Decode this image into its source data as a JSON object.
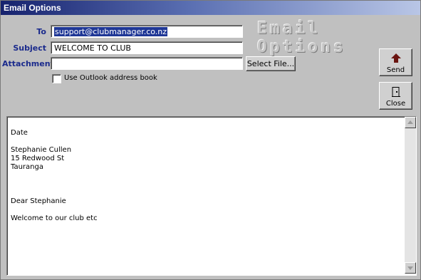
{
  "window": {
    "title": "Email Options"
  },
  "banner": "Email Options",
  "form": {
    "to_label": "To",
    "to_value": "support@clubmanager.co.nz",
    "subject_label": "Subject",
    "subject_value": "WELCOME TO CLUB",
    "attachment_label": "Attachment",
    "attachment_value": "",
    "select_file_label": "Select File...",
    "outlook_label": "Use Outlook address book"
  },
  "buttons": {
    "send_label": "Send",
    "close_label": "Close"
  },
  "message": {
    "body": "Date\n\nStephanie Cullen\n15 Redwood St\nTauranga\n\n\n\nDear Stephanie\n\nWelcome to our club etc"
  },
  "colors": {
    "label_blue": "#1a2a8c",
    "send_arrow": "#6a1410",
    "title_bar": "#16226e"
  }
}
